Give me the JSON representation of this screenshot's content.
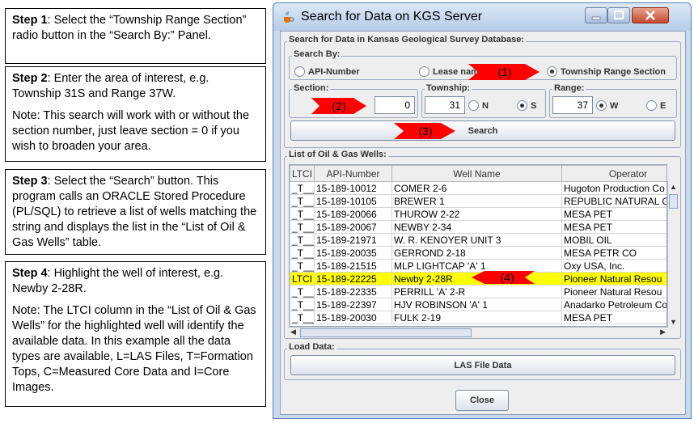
{
  "steps": [
    {
      "heading": "Step 1",
      "text": ": Select the “Township Range Section” radio button in the “Search By:” Panel.",
      "note": ""
    },
    {
      "heading": "Step 2",
      "text": ": Enter the area of interest, e.g. Township 31S and Range 37W.",
      "note": "Note: This search will work with or without the section number, just leave section = 0 if you wish to broaden your area."
    },
    {
      "heading": "Step 3",
      "text": ": Select the “Search” button.  This program calls an ORACLE Stored Procedure (PL/SQL) to retrieve a list of wells matching the string and displays the list in the “List of Oil & Gas Wells” table.",
      "note": ""
    },
    {
      "heading": "Step 4",
      "text": ": Highlight the well of interest, e.g. Newby 2-28R.",
      "note": "Note: The LTCI column in the “List of Oil & Gas Wells” for the highlighted well will identify the available data.  In this example all the data types are available, L=LAS Files, T=Formation Tops, C=Measured Core Data and I=Core Images."
    }
  ],
  "window": {
    "title": "Search for Data on KGS Server",
    "outer_panel_label": "Search for Data in Kansas Geological Survey Database:",
    "search_by": {
      "label": "Search By:",
      "options": [
        {
          "label": "API-Number",
          "selected": false
        },
        {
          "label": "Lease name",
          "selected": false
        },
        {
          "label": "Township Range Section",
          "selected": true
        }
      ]
    },
    "section": {
      "label": "Section:",
      "value": "0"
    },
    "township": {
      "label": "Township:",
      "value": "31",
      "dir_options": [
        {
          "label": "N",
          "selected": false
        },
        {
          "label": "S",
          "selected": true
        }
      ]
    },
    "range": {
      "label": "Range:",
      "value": "37",
      "dir_options": [
        {
          "label": "W",
          "selected": true
        },
        {
          "label": "E",
          "selected": false
        }
      ]
    },
    "search_button": "Search",
    "wells_panel_label": "List of Oil & Gas Wells:",
    "columns": [
      "LTCI",
      "API-Number",
      "Well Name",
      "Operator"
    ],
    "rows": [
      {
        "ltci": "_T__",
        "api": "15-189-10012",
        "name": "COMER 2-6",
        "operator": "Hugoton Production Co",
        "selected": false
      },
      {
        "ltci": "_T__",
        "api": "15-189-10105",
        "name": "BREWER 1",
        "operator": "REPUBLIC NATURAL G",
        "selected": false
      },
      {
        "ltci": "_T__",
        "api": "15-189-20066",
        "name": "THUROW 2-22",
        "operator": "MESA PET",
        "selected": false
      },
      {
        "ltci": "_T__",
        "api": "15-189-20067",
        "name": "NEWBY 2-34",
        "operator": "MESA PET",
        "selected": false
      },
      {
        "ltci": "_T__",
        "api": "15-189-21971",
        "name": "W. R. KENOYER UNIT 3",
        "operator": "MOBIL OIL",
        "selected": false
      },
      {
        "ltci": "_T__",
        "api": "15-189-20035",
        "name": "GERROND 2-18",
        "operator": "MESA PETR CO",
        "selected": false
      },
      {
        "ltci": "_T__",
        "api": "15-189-21515",
        "name": "MLP LIGHTCAP 'A' 1",
        "operator": "Oxy USA, Inc.",
        "selected": false
      },
      {
        "ltci": "LTCI",
        "api": "15-189-22225",
        "name": "Newby 2-28R",
        "operator": "Pioneer Natural Resou",
        "selected": true
      },
      {
        "ltci": "_T__",
        "api": "15-189-22335",
        "name": "PERRILL 'A' 2-R",
        "operator": "Pioneer Natural Resou",
        "selected": false
      },
      {
        "ltci": "_T__",
        "api": "15-189-22397",
        "name": "HJV ROBINSON 'A' 1",
        "operator": "Anadarko Petroleum Co",
        "selected": false
      },
      {
        "ltci": "_T__",
        "api": "15-189-20030",
        "name": "FULK 2-19",
        "operator": "MESA PET",
        "selected": false
      }
    ],
    "load_panel_label": "Load Data:",
    "las_button": "LAS File Data",
    "close_button": "Close"
  },
  "callouts": [
    "(1)",
    "(2)",
    "(3)",
    "(4)"
  ],
  "colors": {
    "arrow": "#ff0000",
    "selected_row": "#ffff00",
    "titlebar": "#c9d9ee"
  }
}
